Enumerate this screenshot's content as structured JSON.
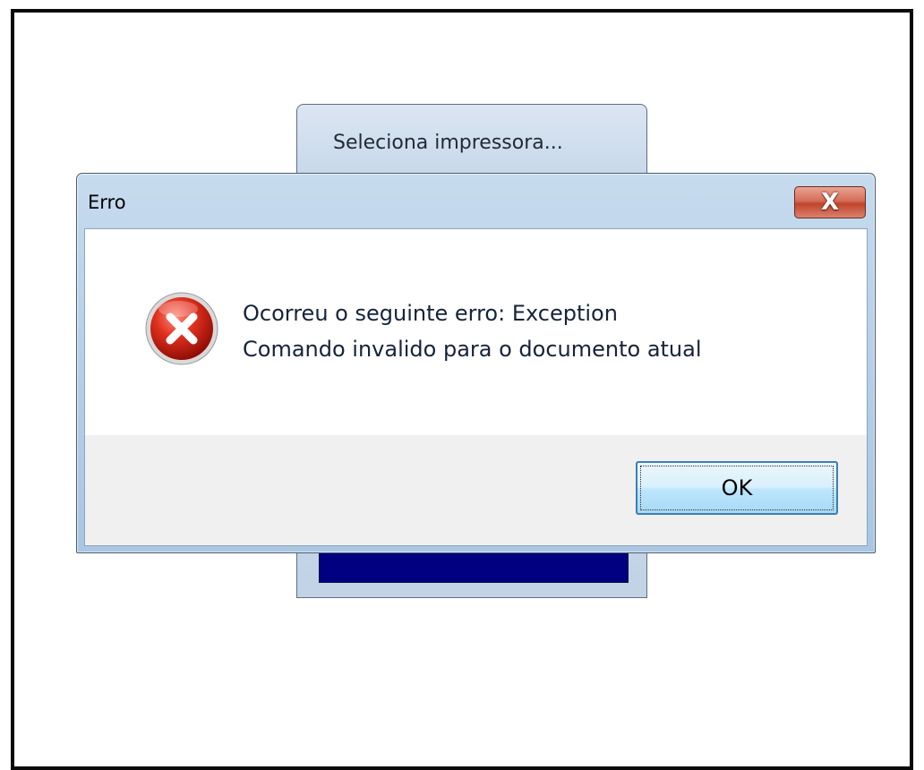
{
  "background_window": {
    "title": "Seleciona impressora..."
  },
  "dialog": {
    "title": "Erro",
    "close_glyph": "X",
    "icon": "error-icon",
    "message_line1": "Ocorreu o seguinte erro: Exception",
    "message_line2": "Comando invalido para o documento atual",
    "ok_label": "OK"
  },
  "colors": {
    "title_bar": "#c7dbee",
    "close_button": "#c2432a",
    "ok_button_border": "#3c7fb1",
    "progress_bar": "#000080"
  }
}
